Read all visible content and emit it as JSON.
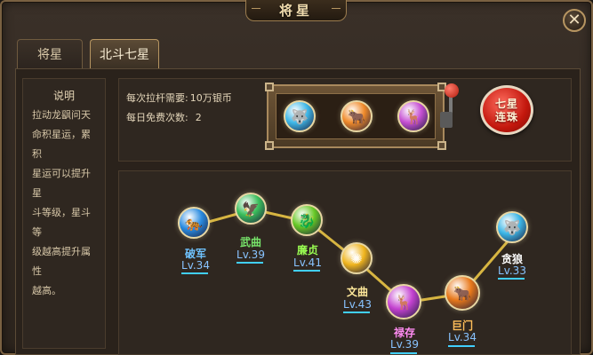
{
  "window": {
    "title": "将星",
    "close_glyph": "✕"
  },
  "tabs": [
    {
      "label": "将星",
      "active": false
    },
    {
      "label": "北斗七星",
      "active": true
    }
  ],
  "description": {
    "title": "说明",
    "lines": [
      "拉动龙飖问天",
      "命积星运，累积",
      "星运可以提升星",
      "斗等级，星斗等",
      "级越高提升属性",
      "越高。"
    ]
  },
  "info": {
    "cost_label": "每次拉杆需要:",
    "cost_value": "10万银币",
    "free_label": "每日免费次数:",
    "free_value": "2"
  },
  "seven_stars_button": {
    "line1": "七星",
    "line2": "连珠"
  },
  "colors": {
    "accent_gold": "#b69561",
    "level_blue": "#88c3ff",
    "level_bar": "#41cfff",
    "connector": "#d7b541"
  },
  "slot_orbs": [
    {
      "icon": "wolf-icon",
      "glyph": "🐺",
      "color": "#3fb8e8"
    },
    {
      "icon": "ox-icon",
      "glyph": "🐂",
      "color": "#f08a2a"
    },
    {
      "icon": "deer-icon",
      "glyph": "🦌",
      "color": "#c54fd2"
    }
  ],
  "stars": [
    {
      "name": "破军",
      "level": "Lv.34",
      "name_color": "#6fc3ff",
      "orb_color": "#2a8be0",
      "icon": "beast-icon",
      "glyph": "🐅",
      "size": "sm"
    },
    {
      "name": "武曲",
      "level": "Lv.39",
      "name_color": "#77e46a",
      "orb_color": "#3bbf5c",
      "icon": "bird-icon",
      "glyph": "🦅",
      "size": "sm"
    },
    {
      "name": "廉贞",
      "level": "Lv.41",
      "name_color": "#9aff52",
      "orb_color": "#67c826",
      "icon": "dragon-icon",
      "glyph": "🐉",
      "size": "sm"
    },
    {
      "name": "文曲",
      "level": "Lv.43",
      "name_color": "#ffe89a",
      "orb_color": "#efb41d",
      "icon": "sun-icon",
      "glyph": "✺",
      "size": "sm"
    },
    {
      "name": "禄存",
      "level": "Lv.39",
      "name_color": "#ff8bf2",
      "orb_color": "#c341cf",
      "icon": "deer-icon",
      "glyph": "🦌",
      "size": "lg"
    },
    {
      "name": "巨门",
      "level": "Lv.34",
      "name_color": "#ffbe5a",
      "orb_color": "#e8781a",
      "icon": "ox-icon",
      "glyph": "🐂",
      "size": "lg"
    },
    {
      "name": "贪狼",
      "level": "Lv.33",
      "name_color": "#ffffff",
      "orb_color": "#3db7e7",
      "icon": "wolf-icon",
      "glyph": "🐺",
      "size": "sm"
    }
  ]
}
